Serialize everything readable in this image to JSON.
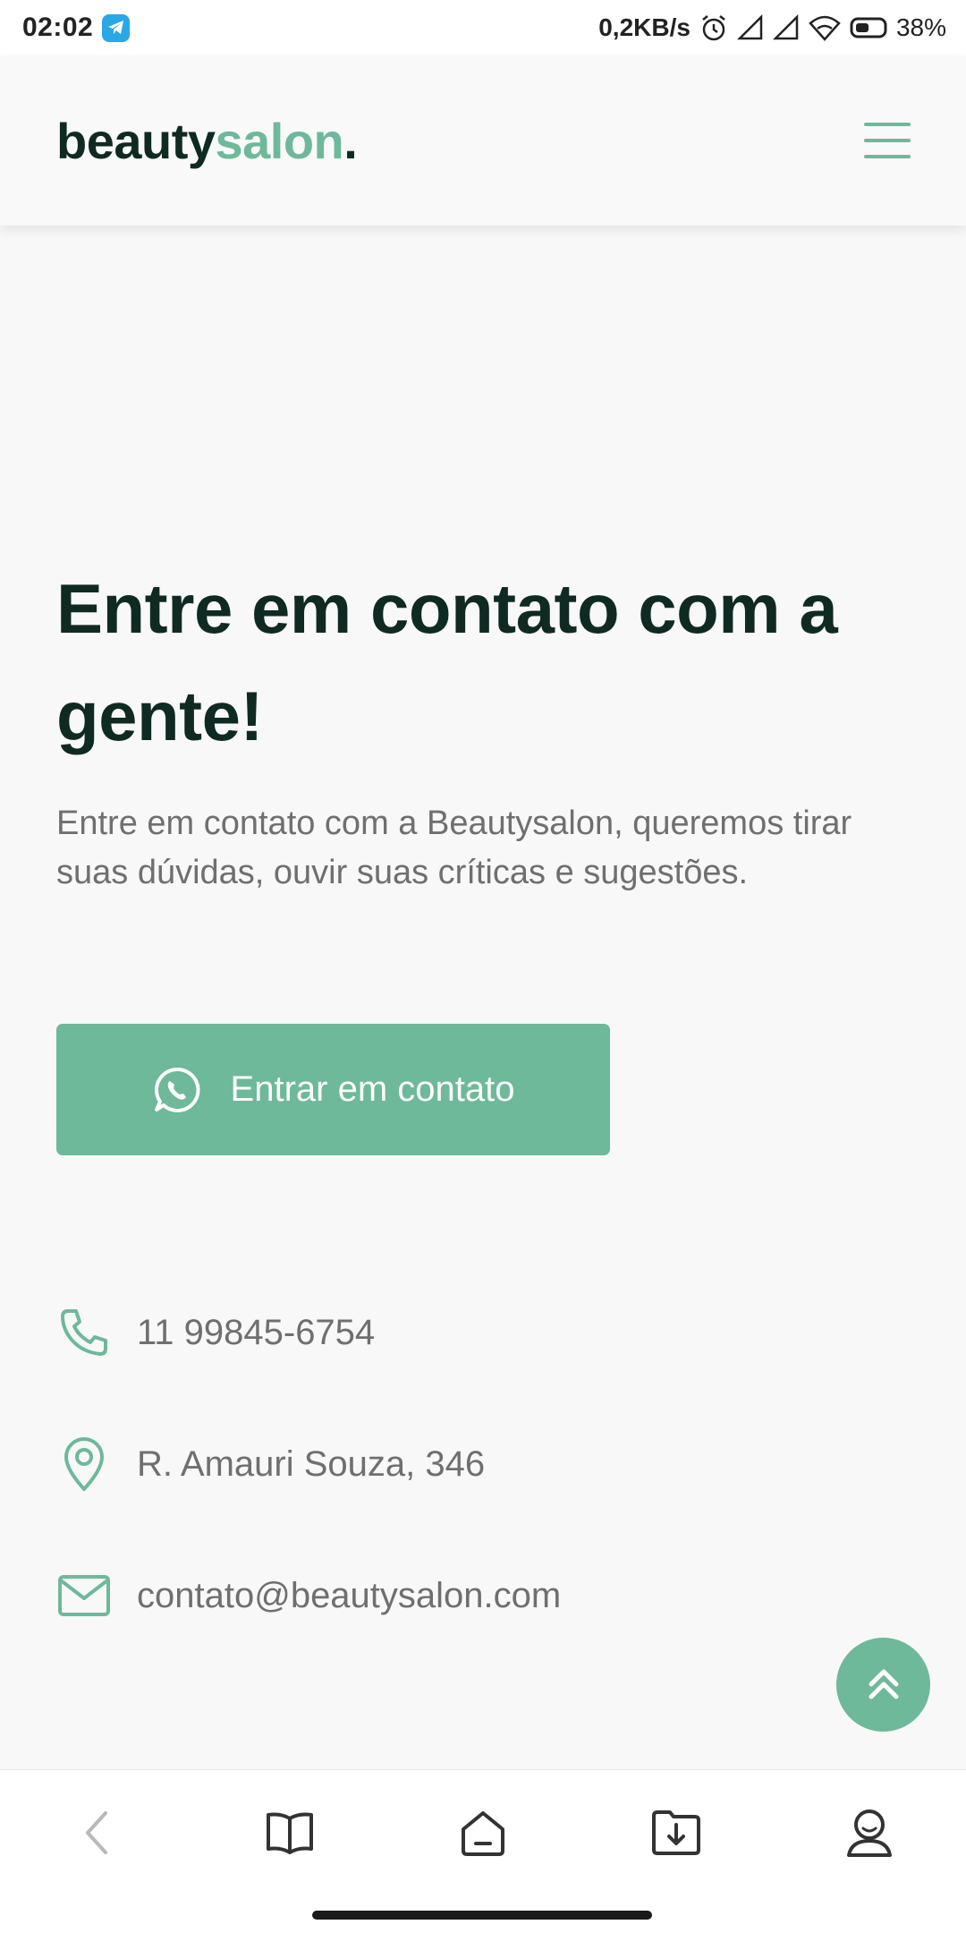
{
  "status_bar": {
    "time": "02:02",
    "net_speed": "0,2KB/s",
    "battery": "38%"
  },
  "header": {
    "logo_part1": "beauty",
    "logo_part2": "salon",
    "logo_part3": ".",
    "menu_icon": "hamburger-icon"
  },
  "hero": {
    "title": "Entre em contato com a gente!",
    "description": "Entre em contato com a Beautysalon, queremos tirar suas dúvidas, ouvir suas críticas e sugestões.",
    "cta_label": "Entrar em contato",
    "cta_icon": "whatsapp-icon"
  },
  "contacts": {
    "phone": "11 99845-6754",
    "address": "R. Amauri Souza, 346",
    "email": "contato@beautysalon.com"
  },
  "colors": {
    "accent": "#6db99a",
    "dark": "#0f2a22",
    "text_muted": "#6f6f6f",
    "background": "#f8f8f8"
  },
  "browser_nav": {
    "icons": [
      "back-icon",
      "bookmarks-icon",
      "home-icon",
      "downloads-icon",
      "profile-icon"
    ]
  }
}
